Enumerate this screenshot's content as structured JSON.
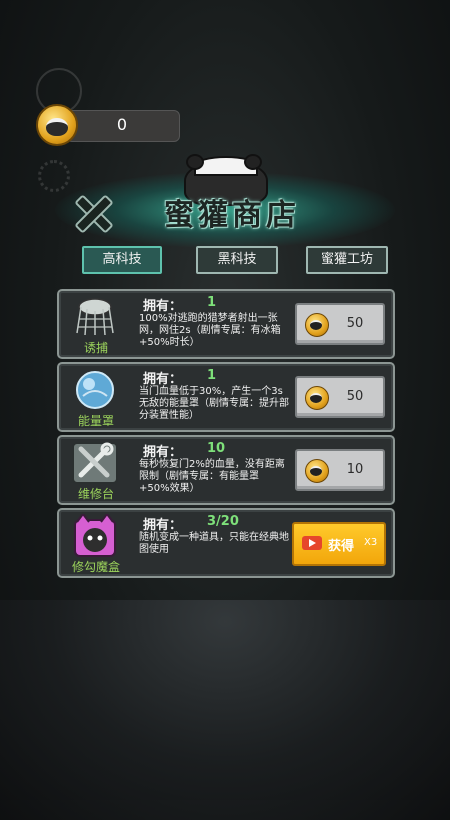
{
  "coins": {
    "value": "0"
  },
  "title": "蜜獾商店",
  "tabs": [
    {
      "label": "高科技",
      "active": true
    },
    {
      "label": "黑科技",
      "active": false
    },
    {
      "label": "蜜獾工坊",
      "active": false
    }
  ],
  "items": [
    {
      "name": "诱捕",
      "own_label": "拥有：",
      "own_value": "1",
      "description": "100%对逃跑的猎梦者射出一张网，网住2s（剧情专属：有冰箱+50%时长）",
      "price": "50"
    },
    {
      "name": "能量罩",
      "own_label": "拥有：",
      "own_value": "1",
      "description": "当门血量低于30%，产生一个3s无敌的能量罩（剧情专属：提升部分装置性能）",
      "price": "50"
    },
    {
      "name": "维修台",
      "own_label": "拥有：",
      "own_value": "10",
      "description": "每秒恢复门2%的血量，没有距离限制（剧情专属：有能量罩+50%效果）",
      "price": "10"
    },
    {
      "name": "修勾魔盒",
      "own_label": "拥有：",
      "own_value": "3/20",
      "description": "随机变成一种道具，只能在经典地图使用",
      "get_label": "获得",
      "get_multiplier": "X3"
    }
  ],
  "colors": {
    "accent_teal": "#5ec2ad",
    "item_name_green": "#9cd45c",
    "own_value_green": "#7ee07a",
    "get_button": "#f2a60b"
  },
  "icons": [
    "coin-icon",
    "gear-icon",
    "close-icon",
    "net-icon",
    "shield-orb-icon",
    "wrench-icon",
    "cat-box-icon",
    "video-icon"
  ]
}
